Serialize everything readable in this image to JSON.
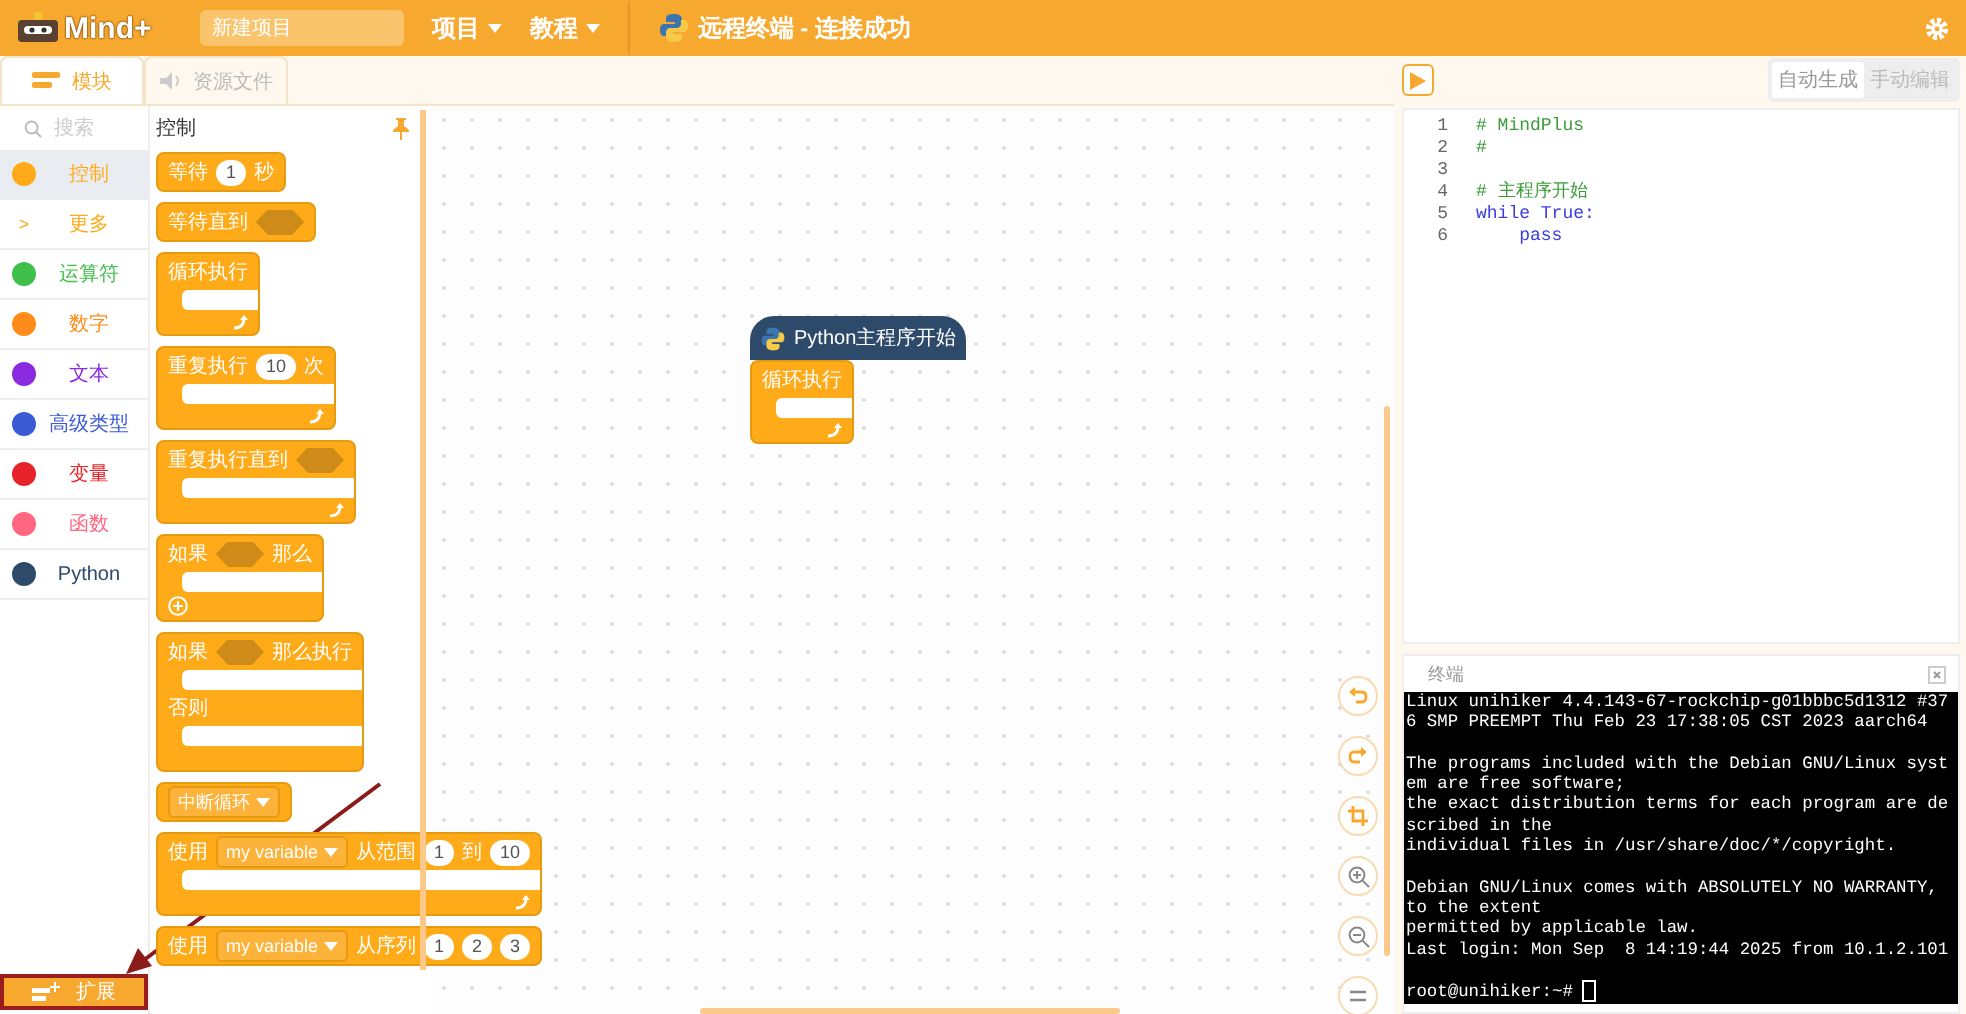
{
  "header": {
    "logo": "Mind+",
    "project_name": "新建项目",
    "menus": [
      {
        "label": "项目"
      },
      {
        "label": "教程"
      }
    ],
    "connection": "远程终端 - 连接成功"
  },
  "tabs": [
    {
      "label": "模块",
      "selected": true,
      "kind": "blocks"
    },
    {
      "label": "资源文件",
      "selected": false,
      "kind": "files"
    }
  ],
  "categories": {
    "search": {
      "placeholder": "搜索"
    },
    "items": [
      {
        "kind": "dot",
        "label": "控制",
        "color": "#ffab19",
        "selected": true
      },
      {
        "kind": "more",
        "glyph": ">",
        "label": "更多",
        "color": "#ffab19",
        "selected": false
      },
      {
        "kind": "dot",
        "label": "运算符",
        "color": "#40bf4a",
        "selected": false
      },
      {
        "kind": "dot",
        "label": "数字",
        "color": "#ff8c1a",
        "selected": false
      },
      {
        "kind": "dot",
        "label": "文本",
        "color": "#8a2be2",
        "selected": false
      },
      {
        "kind": "dot",
        "label": "高级类型",
        "color": "#3b5bd6",
        "selected": false
      },
      {
        "kind": "dot",
        "label": "变量",
        "color": "#e8222a",
        "selected": false
      },
      {
        "kind": "dot",
        "label": "函数",
        "color": "#ff6680",
        "selected": false
      },
      {
        "kind": "dot",
        "label": "Python",
        "color": "#2e4a6b",
        "selected": false
      }
    ]
  },
  "extension_button": {
    "label": "扩展"
  },
  "palette": {
    "title": "控制",
    "blocks": [
      {
        "kind": "stack",
        "parts": [
          {
            "kind": "text",
            "text": "等待"
          },
          {
            "kind": "num",
            "text": "1"
          },
          {
            "kind": "text",
            "text": "秒"
          }
        ]
      },
      {
        "kind": "stack",
        "parts": [
          {
            "kind": "text",
            "text": "等待直到"
          },
          {
            "kind": "hex"
          }
        ]
      },
      {
        "kind": "c",
        "parts": [
          {
            "kind": "text",
            "text": "循环执行"
          }
        ]
      },
      {
        "kind": "c",
        "parts": [
          {
            "kind": "text",
            "text": "重复执行"
          },
          {
            "kind": "num",
            "text": "10"
          },
          {
            "kind": "text",
            "text": "次"
          }
        ]
      },
      {
        "kind": "c",
        "parts": [
          {
            "kind": "text",
            "text": "重复执行直到"
          },
          {
            "kind": "hex"
          }
        ]
      },
      {
        "kind": "if",
        "parts": [
          {
            "kind": "text",
            "text": "如果"
          },
          {
            "kind": "hex"
          },
          {
            "kind": "text",
            "text": "那么"
          }
        ]
      },
      {
        "kind": "ifelse",
        "parts": [
          {
            "kind": "text",
            "text": "如果"
          },
          {
            "kind": "hex"
          },
          {
            "kind": "text",
            "text": "那么执行"
          }
        ],
        "else_label": "否则"
      },
      {
        "kind": "stack",
        "parts": [
          {
            "kind": "dropdown",
            "text": "中断循环"
          }
        ]
      },
      {
        "kind": "c",
        "parts": [
          {
            "kind": "text",
            "text": "使用"
          },
          {
            "kind": "dropdown",
            "text": "my variable"
          },
          {
            "kind": "text",
            "text": "从范围"
          },
          {
            "kind": "num",
            "text": "1"
          },
          {
            "kind": "text",
            "text": "到"
          },
          {
            "kind": "num",
            "text": "10"
          }
        ]
      },
      {
        "kind": "stack",
        "parts": [
          {
            "kind": "text",
            "text": "使用"
          },
          {
            "kind": "dropdown",
            "text": "my variable"
          },
          {
            "kind": "text",
            "text": "从序列"
          },
          {
            "kind": "num",
            "text": "1"
          },
          {
            "kind": "num",
            "text": "2"
          },
          {
            "kind": "num",
            "text": "3"
          }
        ]
      }
    ]
  },
  "workspace": {
    "hat_block": {
      "label": "Python主程序开始"
    },
    "blocks": [
      {
        "kind": "c",
        "parts": [
          {
            "kind": "text",
            "text": "循环执行"
          }
        ]
      }
    ]
  },
  "editor": {
    "modes": [
      {
        "label": "自动生成",
        "selected": true
      },
      {
        "label": "手动编辑",
        "selected": false
      }
    ],
    "lines": [
      {
        "number": "1",
        "kind": "comment",
        "text": "# MindPlus"
      },
      {
        "number": "2",
        "kind": "comment",
        "text": "#"
      },
      {
        "number": "3",
        "kind": "blank"
      },
      {
        "number": "4",
        "kind": "comment",
        "text": "# 主程序开始"
      },
      {
        "number": "5",
        "kind": "keyword",
        "text": "while True:"
      },
      {
        "number": "6",
        "kind": "keyword",
        "text": "    pass"
      }
    ]
  },
  "terminal": {
    "title": "终端",
    "paragraphs": [
      [
        "Linux unihiker 4.4.143-67-rockchip-g01bbbc5d1312 #37",
        "6 SMP PREEMPT Thu Feb 23 17:38:05 CST 2023 aarch64"
      ],
      [
        "The programs included with the Debian GNU/Linux syst",
        "em are free software;",
        "the exact distribution terms for each program are de",
        "scribed in the",
        "individual files in /usr/share/doc/*/copyright."
      ],
      [
        "Debian GNU/Linux comes with ABSOLUTELY NO WARRANTY,",
        "to the extent",
        "permitted by applicable law.",
        "Last login: Mon Sep  8 14:19:44 2025 from 10.1.2.101"
      ]
    ],
    "prompt": "root@unihiker:~#"
  }
}
